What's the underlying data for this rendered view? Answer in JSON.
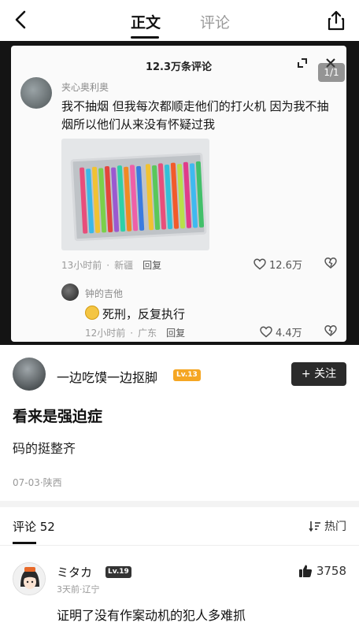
{
  "nav": {
    "tab_main": "正文",
    "tab_comments": "评论"
  },
  "screenshot": {
    "sheet_title": "12.3万条评论",
    "page_indicator": "1/1",
    "comment": {
      "user": "夹心奥利奥",
      "text": "我不抽烟 但我每次都顺走他们的打火机 因为我不抽烟所以他们从来没有怀疑过我",
      "time": "13小时前",
      "location": "新疆",
      "reply_label": "回复",
      "likes": "12.6万"
    },
    "reply": {
      "user": "钟的吉他",
      "text": "死刑，反复执行",
      "time": "12小时前",
      "location": "广东",
      "reply_label": "回复",
      "likes": "4.4万"
    }
  },
  "author": {
    "name": "一边吃馍一边抠脚",
    "level": "Lv.13",
    "follow_label": "+ 关注"
  },
  "post": {
    "title": "看来是强迫症",
    "body": "码的挺整齐",
    "meta": "07-03·陕西"
  },
  "comments": {
    "header": "评论 52",
    "sort_label": "热门",
    "items": [
      {
        "name": "ミタカ",
        "level": "Lv.19",
        "meta": "3天前·辽宁",
        "text": "证明了没有作案动机的犯人多难抓",
        "likes": "3758"
      }
    ]
  }
}
